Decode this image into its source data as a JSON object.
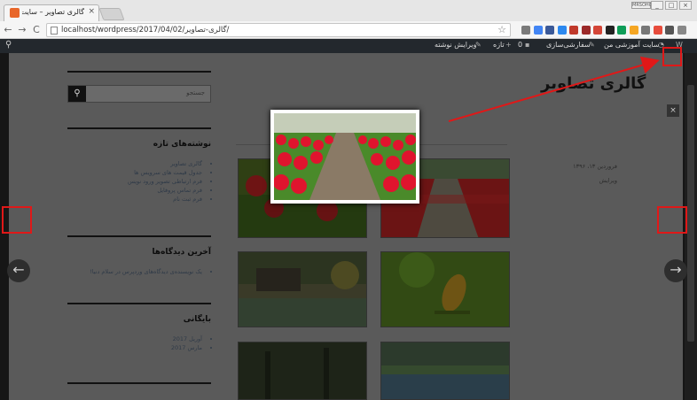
{
  "browser": {
    "tab_title": "گالری تصاویر – سایت آموزشی",
    "tab_close": "×",
    "user_badge": "MRSOHO",
    "window_buttons": [
      "_",
      "□",
      "×"
    ],
    "nav": {
      "back": "←",
      "forward": "→",
      "reload": "C"
    },
    "url": "localhost/wordpress/2017/04/02/گالری-تصاویر/",
    "star": "☆",
    "extension_colors": [
      "#7a7a7a",
      "#4285f4",
      "#3b5998",
      "#2d89ef",
      "#c0392b",
      "#9c2a2a",
      "#d44638",
      "#222222",
      "#0f9d58",
      "#f5a623",
      "#777777",
      "#e74c3c",
      "#555555",
      "#888888"
    ]
  },
  "admin_bar": {
    "wp_logo": "W",
    "site_name": "سایت آموزشی من",
    "customize": "سفارشی‌سازی",
    "comments_count": "0",
    "new": "تازه",
    "edit_post": "ویرایش نوشته",
    "search_icon": "⚲"
  },
  "sidebar": {
    "search_placeholder": "جستجو",
    "search_icon": "⚲",
    "recent_posts_title": "نوشته‌های تازه",
    "recent_posts": [
      "گالری تصاویر",
      "جدول قیمت های سرویس ها",
      "فرم ارتباطی تصویر ورود نویس",
      "فرم تماس پروفایل",
      "فرم ثبت نام"
    ],
    "recent_comments_title": "آخرین دیدگاه‌ها",
    "recent_comments": [
      "یک نویسنده‌ی دیدگاه‌های وردپرس در سلام دنیا!"
    ],
    "archives_title": "بایگانی",
    "archives": [
      "آوریل 2017",
      "مارس 2017"
    ]
  },
  "main": {
    "post_title": "گالری تصاویر",
    "post_date": "فروردین ۱۳، ۱۳۹۶",
    "edit_link": "ویرایش"
  },
  "lightbox": {
    "prev": "←",
    "next": "→",
    "close": "×"
  }
}
